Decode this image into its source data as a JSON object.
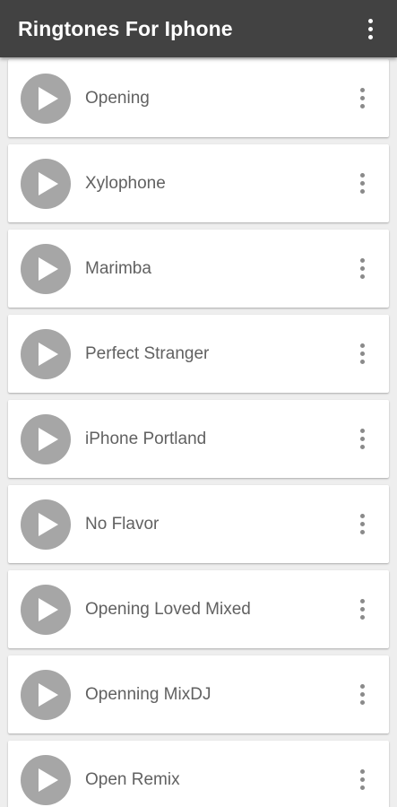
{
  "app": {
    "title": "Ringtones For Iphone"
  },
  "colors": {
    "toolbar": "#424242",
    "background": "#eeeeee",
    "play_button": "#a6a6a6",
    "text": "#616161"
  },
  "icons": {
    "play": "play-icon",
    "overflow": "more-vert-icon"
  },
  "ringtones": [
    {
      "name": "Opening"
    },
    {
      "name": "Xylophone"
    },
    {
      "name": "Marimba"
    },
    {
      "name": "Perfect Stranger"
    },
    {
      "name": "iPhone Portland"
    },
    {
      "name": "No Flavor"
    },
    {
      "name": "Opening Loved Mixed"
    },
    {
      "name": "Openning MixDJ"
    },
    {
      "name": "Open Remix"
    }
  ]
}
